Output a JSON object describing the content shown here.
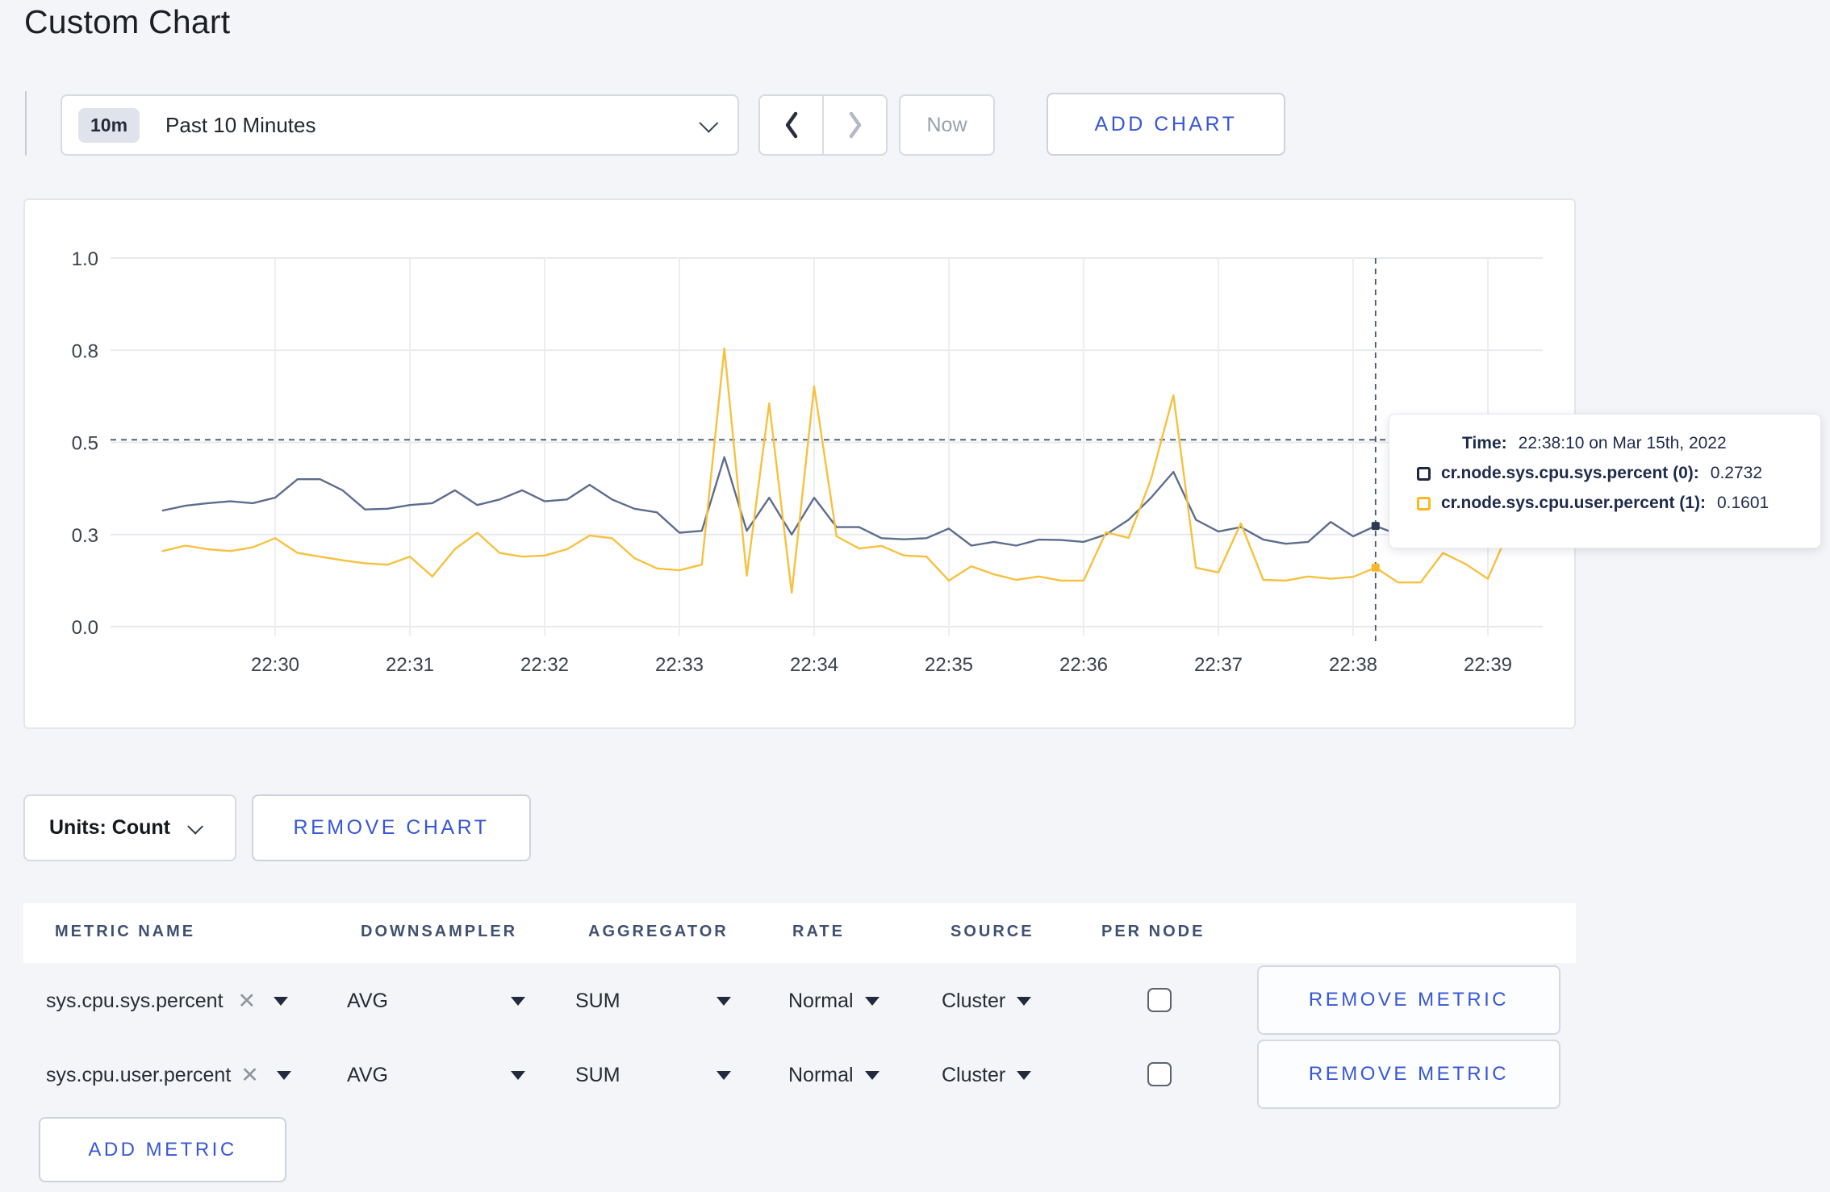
{
  "page": {
    "title": "Custom Chart"
  },
  "toolbar": {
    "time_window_badge": "10m",
    "time_window_label": "Past 10 Minutes",
    "now_label": "Now",
    "add_chart_label": "ADD CHART"
  },
  "chart_data": {
    "type": "line",
    "title": "",
    "xlabel": "",
    "ylabel": "",
    "ylim": [
      0,
      1
    ],
    "grid": true,
    "y_ticks": {
      "values": [
        0,
        0.25,
        0.5,
        0.75,
        1.0
      ],
      "labels": [
        "0.0",
        "0.3",
        "0.5",
        "0.8",
        "1.0"
      ]
    },
    "x_ticks": [
      "22:30",
      "22:31",
      "22:32",
      "22:33",
      "22:34",
      "22:35",
      "22:36",
      "22:37",
      "22:38",
      "22:39"
    ],
    "x_start": "22:29:10",
    "x_step_seconds": 10,
    "series": [
      {
        "name": "cr.node.sys.cpu.sys.percent",
        "color": "#5d6d8e",
        "values": [
          0.315,
          0.328,
          0.335,
          0.34,
          0.335,
          0.35,
          0.4,
          0.4,
          0.37,
          0.318,
          0.32,
          0.33,
          0.335,
          0.37,
          0.33,
          0.345,
          0.37,
          0.34,
          0.345,
          0.385,
          0.345,
          0.32,
          0.31,
          0.255,
          0.26,
          0.46,
          0.26,
          0.35,
          0.25,
          0.35,
          0.27,
          0.27,
          0.24,
          0.237,
          0.24,
          0.266,
          0.22,
          0.23,
          0.22,
          0.236,
          0.235,
          0.23,
          0.25,
          0.29,
          0.35,
          0.42,
          0.29,
          0.258,
          0.27,
          0.236,
          0.225,
          0.23,
          0.284,
          0.245,
          0.2732,
          0.25,
          0.26,
          0.265,
          0.27,
          0.27,
          0.3,
          0.3
        ]
      },
      {
        "name": "cr.node.sys.cpu.user.percent",
        "color": "#f7c13e",
        "values": [
          0.205,
          0.22,
          0.21,
          0.205,
          0.215,
          0.24,
          0.2,
          0.19,
          0.18,
          0.172,
          0.168,
          0.19,
          0.136,
          0.21,
          0.255,
          0.2,
          0.19,
          0.193,
          0.21,
          0.247,
          0.24,
          0.186,
          0.158,
          0.153,
          0.168,
          0.755,
          0.138,
          0.606,
          0.092,
          0.652,
          0.245,
          0.212,
          0.219,
          0.193,
          0.19,
          0.125,
          0.164,
          0.142,
          0.127,
          0.136,
          0.125,
          0.125,
          0.256,
          0.241,
          0.4,
          0.628,
          0.16,
          0.147,
          0.28,
          0.127,
          0.125,
          0.136,
          0.13,
          0.135,
          0.1601,
          0.12,
          0.12,
          0.2,
          0.17,
          0.13,
          0.27,
          0.25
        ]
      }
    ],
    "crosshair": {
      "time": "22:38:10",
      "y_value": 0.507,
      "points": [
        0.2732,
        0.1601
      ],
      "point_colors": [
        "#2c3a55",
        "#f9b826"
      ],
      "color": "#46586f"
    },
    "legend_position": "tooltip"
  },
  "tooltip": {
    "time_label": "Time:",
    "time_value": "22:38:10 on Mar 15th, 2022",
    "rows": [
      {
        "name": "cr.node.sys.cpu.sys.percent (0):",
        "value": "0.2732",
        "swatch": "#1b2942"
      },
      {
        "name": "cr.node.sys.cpu.user.percent (1):",
        "value": "0.1601",
        "swatch": "#fdb81d"
      }
    ]
  },
  "chart_footer": {
    "units_label": "Units: Count",
    "remove_chart_label": "REMOVE CHART"
  },
  "metrics_table": {
    "headers": [
      "METRIC NAME",
      "DOWNSAMPLER",
      "AGGREGATOR",
      "RATE",
      "SOURCE",
      "PER NODE"
    ],
    "close_glyph": "✕",
    "rows": [
      {
        "metric": "sys.cpu.sys.percent",
        "downsampler": "AVG",
        "aggregator": "SUM",
        "rate": "Normal",
        "source": "Cluster",
        "per_node_checked": false,
        "remove_label": "REMOVE METRIC"
      },
      {
        "metric": "sys.cpu.user.percent",
        "downsampler": "AVG",
        "aggregator": "SUM",
        "rate": "Normal",
        "source": "Cluster",
        "per_node_checked": false,
        "remove_label": "REMOVE METRIC"
      }
    ],
    "add_metric_label": "ADD METRIC"
  },
  "colors": {
    "accent_blue": "#3757d6",
    "navy": "#1d2b4c",
    "page_bg": "#f4f5f8"
  }
}
